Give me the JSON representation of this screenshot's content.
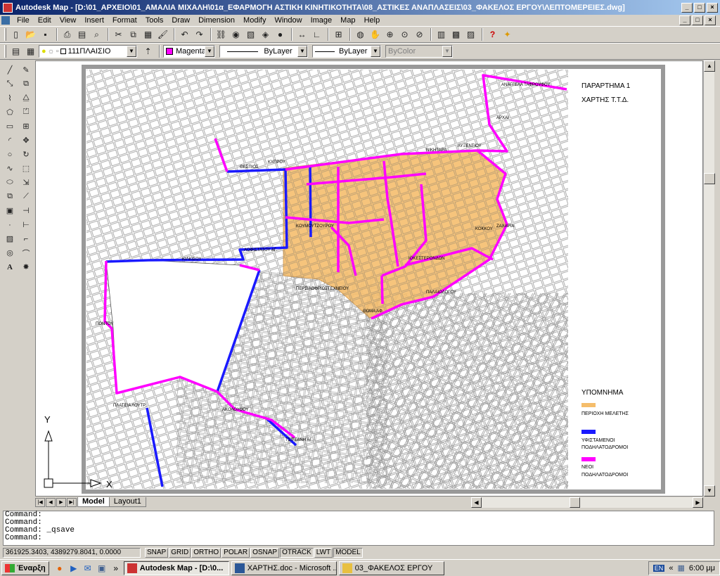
{
  "window": {
    "title": "Autodesk Map - [D:\\01_ΑΡΧΕΙΟ\\01_ΑΜΑΛΙΑ ΜΙΧΑΛΗ\\01α_ΕΦΑΡΜΟΓΗ ΑΣΤΙΚΗ ΚΙΝΗΤΙΚΟΤΗΤΑ\\08_ΑΣΤΙΚΕΣ ΑΝΑΠΛΑΣΕΙΣ\\03_ΦΑΚΕΛΟΣ ΕΡΓΟΥ\\ΛΕΠΤΟΜΕΡΕΙΕΣ.dwg]",
    "minimize": "_",
    "maximize": "□",
    "close": "×"
  },
  "menu": [
    "File",
    "Edit",
    "View",
    "Insert",
    "Format",
    "Tools",
    "Draw",
    "Dimension",
    "Modify",
    "Window",
    "Image",
    "Map",
    "Help"
  ],
  "properties": {
    "layer": "111ΠΛΑΙΣΙΟ",
    "color": "Magenta",
    "color_hex": "#ff00ff",
    "linetype": "ByLayer",
    "lineweight": "ByLayer",
    "plotstyle": "ByColor"
  },
  "map": {
    "title_line1": "ΠΑΡΑΡΤΗΜΑ 1",
    "title_line2": "ΧΑΡΤΗΣ Τ.Τ.Δ.",
    "legend_title": "ΥΠΟΜΝΗΜΑ",
    "legend": [
      {
        "label": "ΠΕΡΙΟΧΗ ΜΕΛΕΤΗΣ",
        "color": "#f5bd6b"
      },
      {
        "label": "ΥΦΙΣΤΑΜΕΝΟΙ",
        "label2": "ΠΟΔΗΛΑΤΟΔΡΟΜΟΙ",
        "color": "#1a1aff"
      },
      {
        "label": "ΝΕΟΙ",
        "label2": "ΠΟΔΗΛΑΤΟΔΡΟΜΟΙ",
        "color": "#ff00ff"
      }
    ],
    "ucs_x": "X",
    "ucs_y": "Y"
  },
  "tabs": {
    "model": "Model",
    "layout1": "Layout1"
  },
  "command": {
    "line1": "Command:",
    "line2": "Command:",
    "line3": "Command: _qsave",
    "line4": "Command:"
  },
  "status": {
    "coords": "361925.3403, 4389279.8041, 0.0000",
    "toggles": [
      "SNAP",
      "GRID",
      "ORTHO",
      "POLAR",
      "OSNAP",
      "OTRACK",
      "LWT",
      "MODEL"
    ]
  },
  "taskbar": {
    "start": "Έναρξη",
    "items": [
      "Autodesk Map - [D:\\0...",
      "ΧΑΡΤΗΣ.doc - Microsoft ...",
      "03_ΦΑΚΕΛΟΣ ΕΡΓΟΥ"
    ],
    "lang": "EN",
    "clock": "6:00 μμ"
  }
}
